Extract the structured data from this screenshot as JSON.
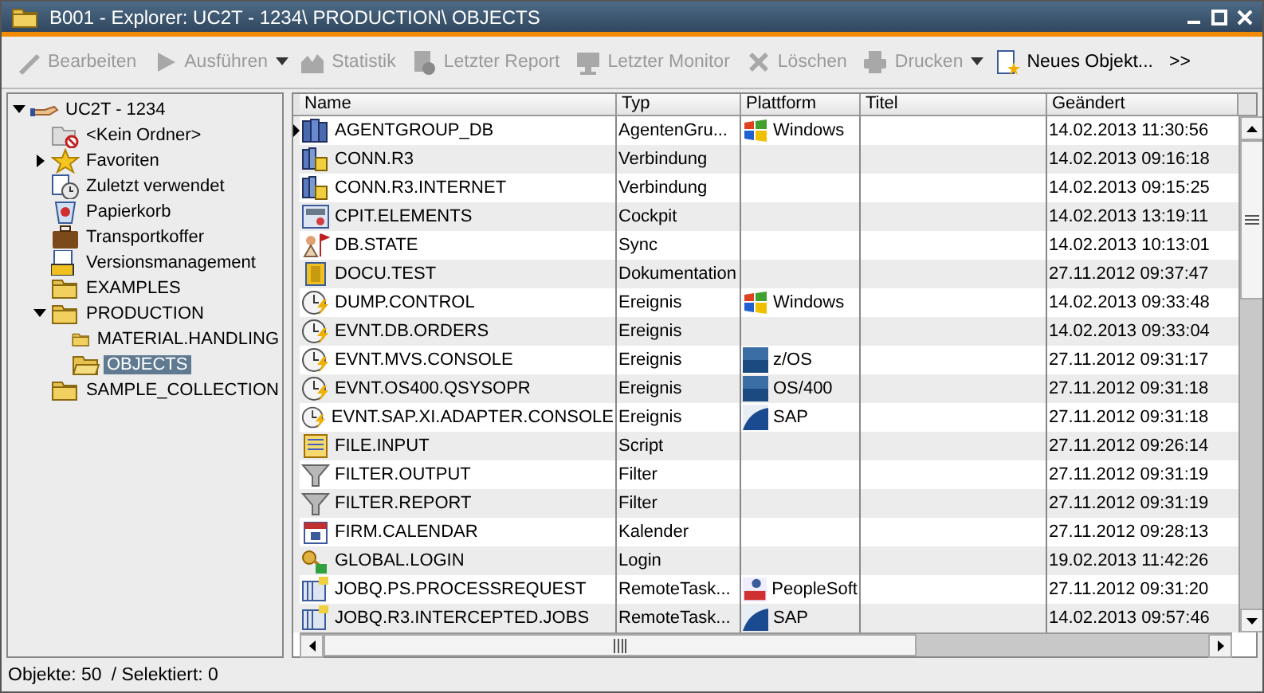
{
  "window": {
    "title": "B001 - Explorer: UC2T - 1234\\ PRODUCTION\\ OBJECTS"
  },
  "toolbar": [
    {
      "label": "Bearbeiten",
      "kind": "edit",
      "disabled": true,
      "dropdown": false
    },
    {
      "label": "Ausführen",
      "kind": "run",
      "disabled": true,
      "dropdown": true
    },
    {
      "label": "Statistik",
      "kind": "stats",
      "disabled": true,
      "dropdown": false
    },
    {
      "label": "Letzter Report",
      "kind": "report",
      "disabled": true,
      "dropdown": false
    },
    {
      "label": "Letzter Monitor",
      "kind": "monitor",
      "disabled": true,
      "dropdown": false
    },
    {
      "label": "Löschen",
      "kind": "delete",
      "disabled": true,
      "dropdown": false
    },
    {
      "label": "Drucken",
      "kind": "print",
      "disabled": true,
      "dropdown": true
    },
    {
      "label": "Neues Objekt...",
      "kind": "new",
      "disabled": false,
      "dropdown": false
    }
  ],
  "toolbar_overflow": ">>",
  "tree": [
    {
      "label": "UC2T - 1234",
      "kind": "client",
      "expanded": true,
      "selected": false,
      "children": [
        {
          "label": "<Kein Ordner>",
          "kind": "nofolder",
          "selected": false
        },
        {
          "label": "Favoriten",
          "kind": "star",
          "expanded": false,
          "selected": false
        },
        {
          "label": "Zuletzt verwendet",
          "kind": "recent",
          "selected": false
        },
        {
          "label": "Papierkorb",
          "kind": "bin",
          "selected": false
        },
        {
          "label": "Transportkoffer",
          "kind": "case",
          "selected": false
        },
        {
          "label": "Versionsmanagement",
          "kind": "version",
          "selected": false
        },
        {
          "label": "EXAMPLES",
          "kind": "folder",
          "selected": false
        },
        {
          "label": "PRODUCTION",
          "kind": "folder",
          "expanded": true,
          "selected": false,
          "children": [
            {
              "label": "MATERIAL.HANDLING",
              "kind": "folder",
              "selected": false
            },
            {
              "label": "OBJECTS",
              "kind": "openfolder",
              "selected": true
            }
          ]
        },
        {
          "label": "SAMPLE_COLLECTION",
          "kind": "folder",
          "selected": false
        }
      ]
    }
  ],
  "table": {
    "columns": [
      "Name",
      "Typ",
      "Plattform",
      "Titel",
      "Geändert"
    ],
    "rows": [
      {
        "name": "AGENTGROUP_DB",
        "kind": "agentgroup",
        "current": true,
        "type": "AgentenGru...",
        "platform": {
          "label": "Windows",
          "kind": "windows"
        },
        "changed": "14.02.2013 11:30:56"
      },
      {
        "name": "CONN.R3",
        "kind": "conn",
        "current": false,
        "type": "Verbindung",
        "changed": "14.02.2013 09:16:18"
      },
      {
        "name": "CONN.R3.INTERNET",
        "kind": "conn",
        "current": false,
        "type": "Verbindung",
        "changed": "14.02.2013 09:15:25"
      },
      {
        "name": "CPIT.ELEMENTS",
        "kind": "cockpit",
        "current": false,
        "type": "Cockpit",
        "changed": "14.02.2013 13:19:11"
      },
      {
        "name": "DB.STATE",
        "kind": "sync",
        "current": false,
        "type": "Sync",
        "changed": "14.02.2013 10:13:01"
      },
      {
        "name": "DOCU.TEST",
        "kind": "doc",
        "current": false,
        "type": "Dokumentation",
        "changed": "27.11.2012 09:37:47"
      },
      {
        "name": "DUMP.CONTROL",
        "kind": "event",
        "current": false,
        "type": "Ereignis",
        "platform": {
          "label": "Windows",
          "kind": "windows"
        },
        "changed": "14.02.2013 09:33:48"
      },
      {
        "name": "EVNT.DB.ORDERS",
        "kind": "event",
        "current": false,
        "type": "Ereignis",
        "changed": "14.02.2013 09:33:04"
      },
      {
        "name": "EVNT.MVS.CONSOLE",
        "kind": "event",
        "current": false,
        "type": "Ereignis",
        "platform": {
          "label": "z/OS",
          "kind": "zos"
        },
        "changed": "27.11.2012 09:31:17"
      },
      {
        "name": "EVNT.OS400.QSYSOPR",
        "kind": "event",
        "current": false,
        "type": "Ereignis",
        "platform": {
          "label": "OS/400",
          "kind": "os400"
        },
        "changed": "27.11.2012 09:31:18"
      },
      {
        "name": "EVNT.SAP.XI.ADAPTER.CONSOLE",
        "kind": "event",
        "current": false,
        "type": "Ereignis",
        "platform": {
          "label": "SAP",
          "kind": "sap"
        },
        "changed": "27.11.2012 09:31:18"
      },
      {
        "name": "FILE.INPUT",
        "kind": "script",
        "current": false,
        "type": "Script",
        "changed": "27.11.2012 09:26:14"
      },
      {
        "name": "FILTER.OUTPUT",
        "kind": "filter",
        "current": false,
        "type": "Filter",
        "changed": "27.11.2012 09:31:19"
      },
      {
        "name": "FILTER.REPORT",
        "kind": "filter",
        "current": false,
        "type": "Filter",
        "changed": "27.11.2012 09:31:19"
      },
      {
        "name": "FIRM.CALENDAR",
        "kind": "calendar",
        "current": false,
        "type": "Kalender",
        "changed": "27.11.2012 09:28:13"
      },
      {
        "name": "GLOBAL.LOGIN",
        "kind": "login",
        "current": false,
        "type": "Login",
        "changed": "19.02.2013 11:42:26"
      },
      {
        "name": "JOBQ.PS.PROCESSREQUEST",
        "kind": "jobq",
        "current": false,
        "type": "RemoteTask...",
        "platform": {
          "label": "PeopleSoft",
          "kind": "peoplesoft"
        },
        "changed": "27.11.2012 09:31:20"
      },
      {
        "name": "JOBQ.R3.INTERCEPTED.JOBS",
        "kind": "jobq",
        "current": false,
        "type": "RemoteTask...",
        "platform": {
          "label": "SAP",
          "kind": "sap"
        },
        "changed": "14.02.2013 09:57:46"
      }
    ]
  },
  "status_bar": {
    "objects": "Objekte: 50",
    "selected": "/ Selektiert: 0"
  }
}
